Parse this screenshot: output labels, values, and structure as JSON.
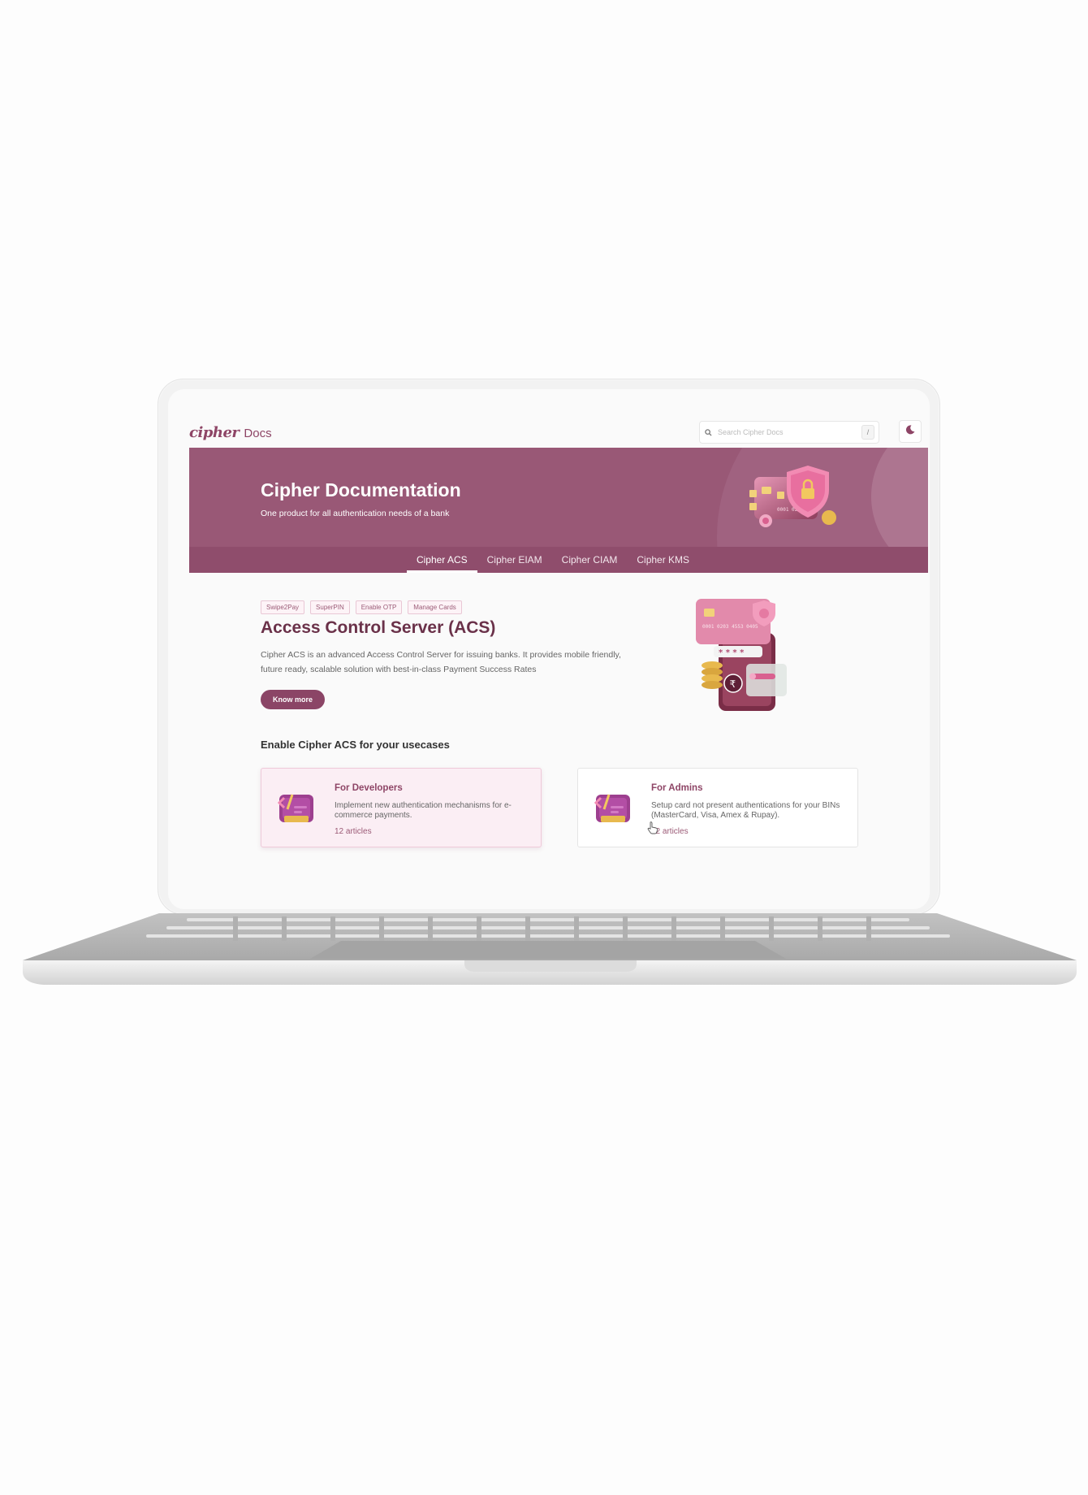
{
  "header": {
    "logo_word": "cipher",
    "logo_suffix": "Docs",
    "search_placeholder": "Search Cipher Docs",
    "search_shortcut": "/",
    "theme_toggle_icon": "moon-icon"
  },
  "banner": {
    "title": "Cipher Documentation",
    "subtitle": "One product for all authentication needs of a bank",
    "tabs": [
      {
        "label": "Cipher ACS",
        "active": true
      },
      {
        "label": "Cipher EIAM",
        "active": false
      },
      {
        "label": "Cipher CIAM",
        "active": false
      },
      {
        "label": "Cipher KMS",
        "active": false
      }
    ],
    "art_icon": "credit-card-shield-illustration",
    "card_number_text": "0001 0203"
  },
  "product": {
    "tags": [
      "Swipe2Pay",
      "SuperPIN",
      "Enable OTP",
      "Manage Cards"
    ],
    "title": "Access Control Server (ACS)",
    "description": "Cipher ACS is an advanced Access Control Server for issuing banks. It provides mobile friendly, future ready, scalable solution with best-in-class Payment Success Rates",
    "cta_label": "Know more",
    "art_icon": "phone-card-payment-illustration",
    "card_number_text": "0001 0203 4553 0405",
    "pin_mask": "* * * *"
  },
  "usecases": {
    "heading": "Enable Cipher ACS for your usecases",
    "cards": [
      {
        "title": "For Developers",
        "description": "Implement new authentication mechanisms for e-commerce payments.",
        "count": "12 articles",
        "icon": "developer-code-card-icon",
        "hovered": true
      },
      {
        "title": "For Admins",
        "description": "Setup card not present authentications for your BINs (MasterCard, Visa, Amex & Rupay).",
        "count": "12 articles",
        "icon": "admin-code-card-icon",
        "hovered": false
      }
    ]
  },
  "colors": {
    "brand": "#8e4566",
    "banner": "#995876",
    "tab_bar": "#8f4d6c",
    "title_dark": "#6a3149",
    "card_hover_bg": "#fbeef4"
  }
}
